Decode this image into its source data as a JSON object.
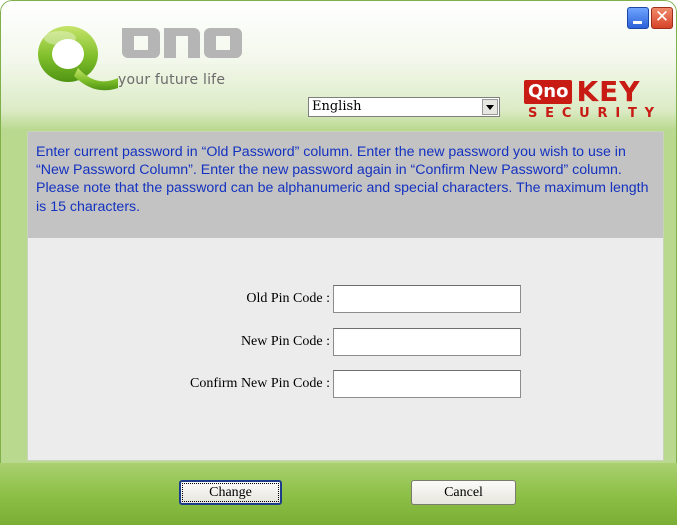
{
  "window": {
    "close_glyph": "✕",
    "accent_green": "#8bbf44",
    "text_blue": "#1432c0"
  },
  "header": {
    "brand_name": "QNO",
    "tagline": "your future life",
    "product_logo_qno": "Qno",
    "product_logo_key": "KEY",
    "product_logo_sub": "SECURITY",
    "language": {
      "selected": "English"
    }
  },
  "instructions": "Enter current password in “Old Password” column. Enter the new password you wish to use in “New Password Column”. Enter the new password again in “Confirm New Password” column. Please note that the password can be alphanumeric and special characters. The maximum length is 15 characters.",
  "form": {
    "old_pin_label": "Old Pin Code :",
    "new_pin_label": "New Pin Code :",
    "confirm_pin_label": "Confirm New Pin Code :",
    "old_pin_value": "",
    "new_pin_value": "",
    "confirm_pin_value": ""
  },
  "buttons": {
    "change": "Change",
    "cancel": "Cancel"
  }
}
